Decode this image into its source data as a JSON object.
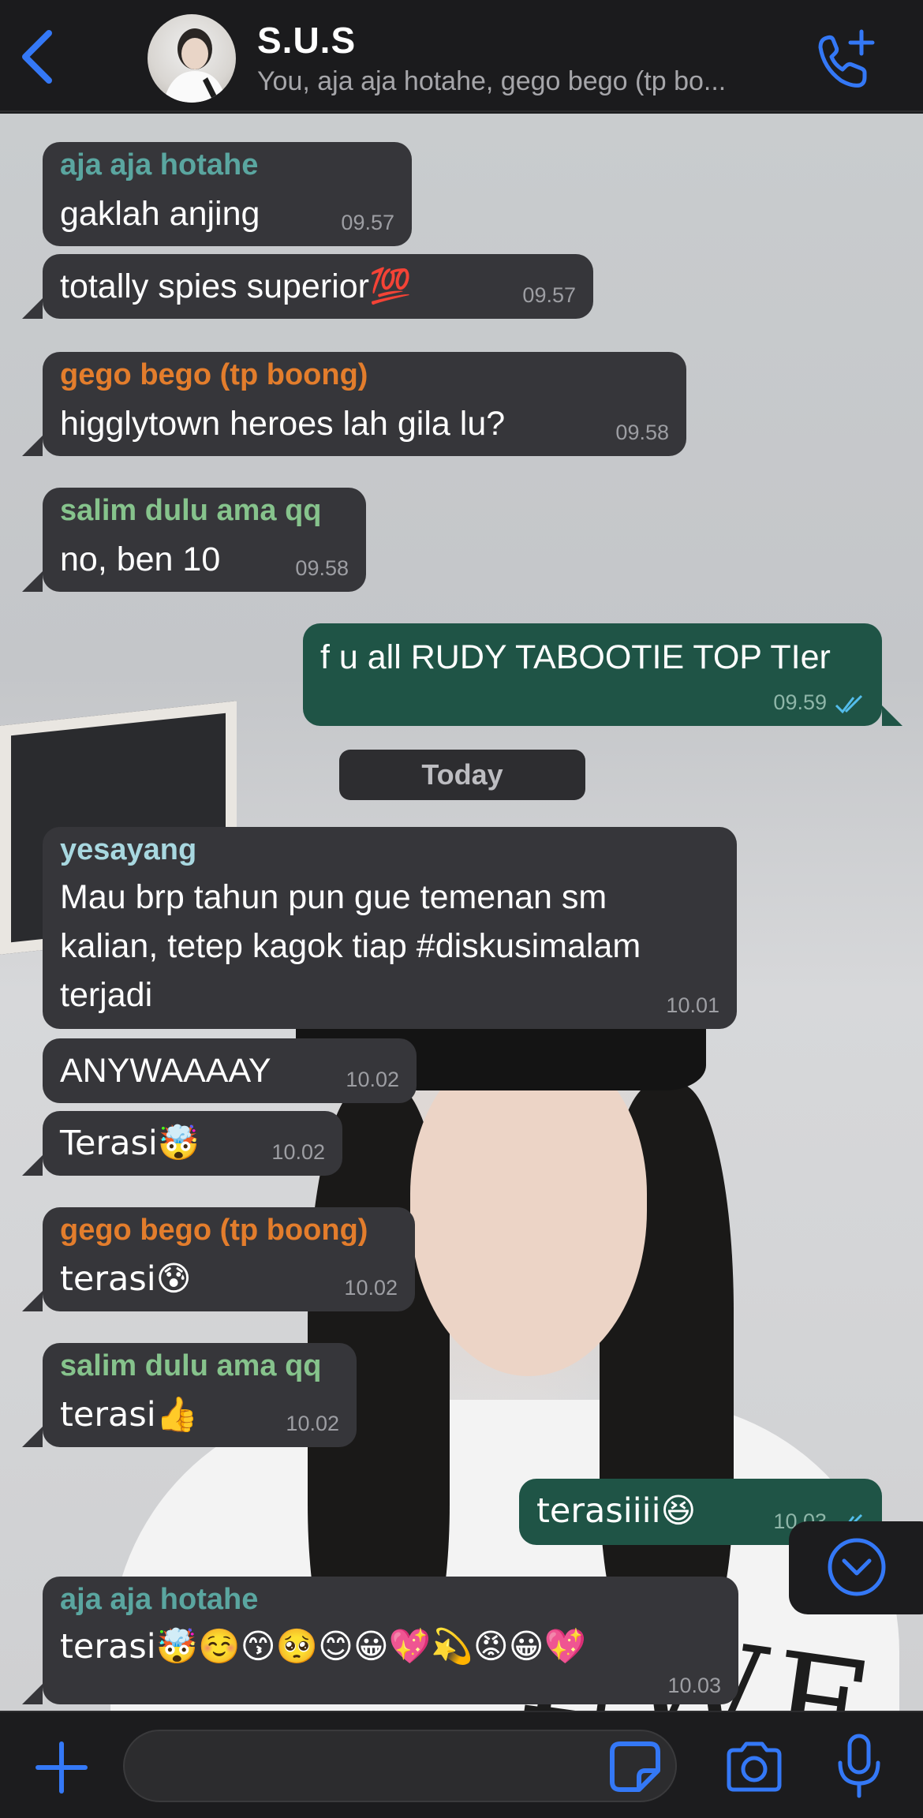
{
  "header": {
    "title": "S.U.S",
    "subtitle": "You, aja aja hotahe, gego bego (tp bo..."
  },
  "colors": {
    "accent": "#3478f6",
    "incoming_bubble": "#36363a",
    "outgoing_bubble": "#1f5446",
    "sender_teal": "#5aa6a0",
    "sender_orange": "#e37d2c",
    "sender_green": "#86c38c",
    "sender_lightblue": "#a8d8e0"
  },
  "messages": [
    {
      "sender": "aja aja hotahe",
      "text": "gaklah anjing",
      "time": "09.57"
    },
    {
      "text": "totally spies superior💯",
      "time": "09.57"
    },
    {
      "sender": "gego bego (tp boong)",
      "text": "higglytown heroes lah gila lu?",
      "time": "09.58"
    },
    {
      "sender": "salim dulu ama qq",
      "text": "no, ben 10",
      "time": "09.58"
    },
    {
      "text": "f u all RUDY TABOOTIE TOP TIer",
      "time": "09.59",
      "outgoing": true,
      "read": true
    },
    {
      "sender": "yesayang",
      "text_lines": [
        "Mau brp tahun pun gue temenan sm",
        "kalian, tetep kagok tiap #diskusimalam",
        "terjadi"
      ],
      "time": "10.01"
    },
    {
      "text": "ANYWAAAAY",
      "time": "10.02"
    },
    {
      "text": "Terasi🤯",
      "time": "10.02"
    },
    {
      "sender": "gego bego (tp boong)",
      "text": "terasi😰",
      "time": "10.02"
    },
    {
      "sender": "salim dulu ama qq",
      "text": "terasi👍",
      "time": "10.02"
    },
    {
      "text": "terasiiii😆",
      "time": "10.03",
      "outgoing": true,
      "read": true
    },
    {
      "sender": "aja aja hotahe",
      "text": "terasi🤯☺️😙🥺😊😀💖💫😡😀💖",
      "time": "10.03"
    }
  ],
  "date_separator": "Today",
  "input": {
    "value": "",
    "placeholder": ""
  },
  "icons": {
    "back": "chevron-left-icon",
    "call": "phone-plus-icon",
    "scroll": "chevron-down-circle-icon",
    "attach": "plus-icon",
    "sticker": "sticker-icon",
    "camera": "camera-icon",
    "mic": "microphone-icon"
  }
}
